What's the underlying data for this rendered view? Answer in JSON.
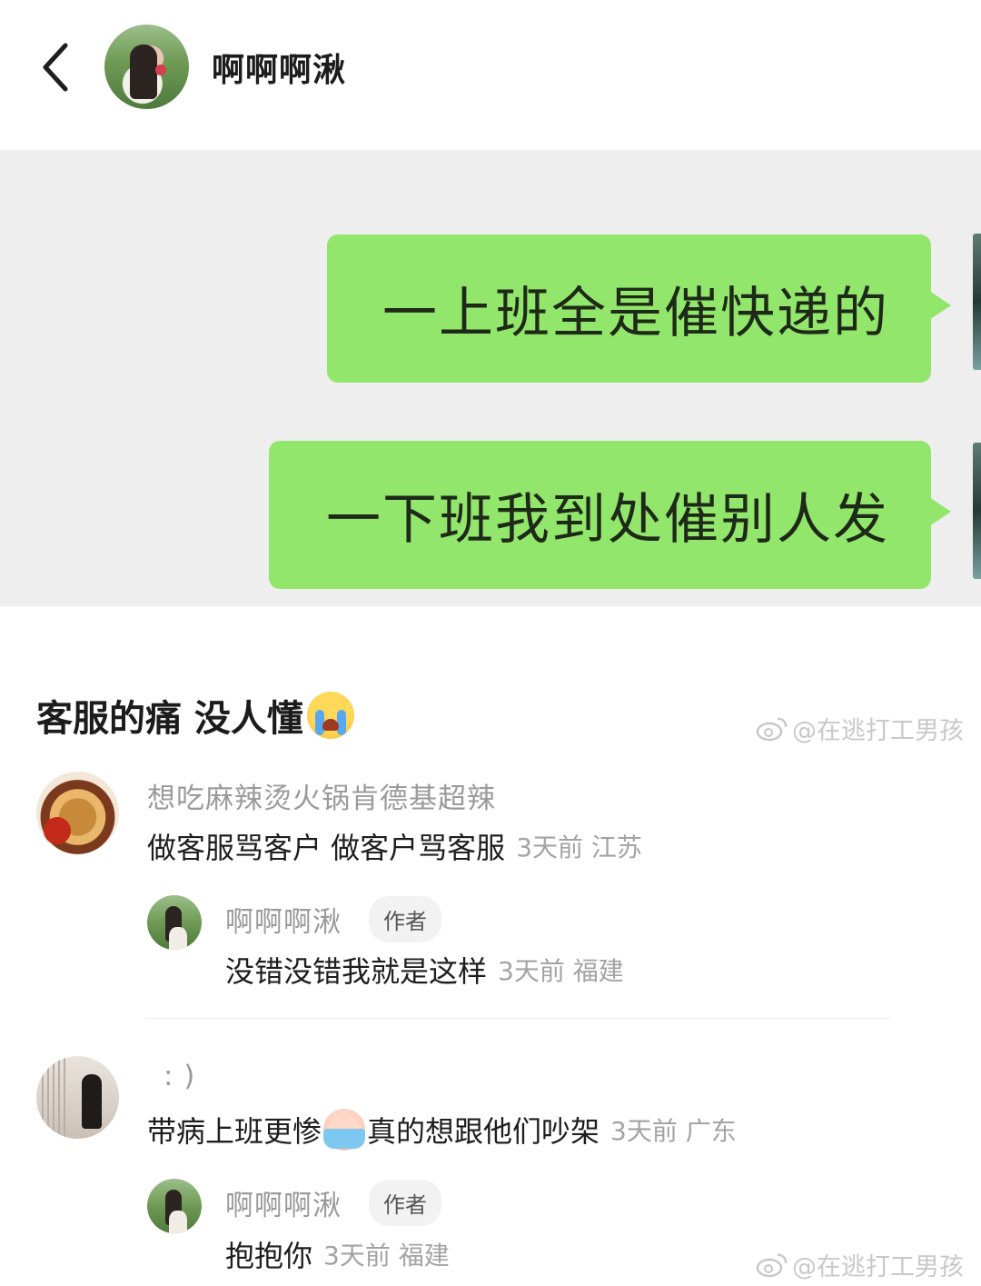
{
  "header": {
    "title": "啊啊啊湫"
  },
  "chat": {
    "messages": [
      "一上班全是催快递的",
      "一下班我到处催别人发"
    ]
  },
  "post": {
    "title": "客服的痛 没人懂",
    "title_emoji": "loudly-crying-face-icon"
  },
  "watermark": {
    "text": "@在逃打工男孩"
  },
  "comments": [
    {
      "name": "想吃麻辣烫火锅肯德基超辣",
      "text": "做客服骂客户 做客户骂客服",
      "meta": "3天前 江苏",
      "reply": {
        "name": "啊啊啊湫",
        "tag": "作者",
        "text": "没错没错我就是这样",
        "meta": "3天前 福建"
      }
    },
    {
      "name": ": )",
      "text_before": "带病上班更惨",
      "text_emoji": "sick-face-icon",
      "text_after": "真的想跟他们吵架",
      "meta": "3天前 广东",
      "reply": {
        "name": "啊啊啊湫",
        "tag": "作者",
        "text": "抱抱你",
        "meta": "3天前 福建"
      }
    }
  ]
}
